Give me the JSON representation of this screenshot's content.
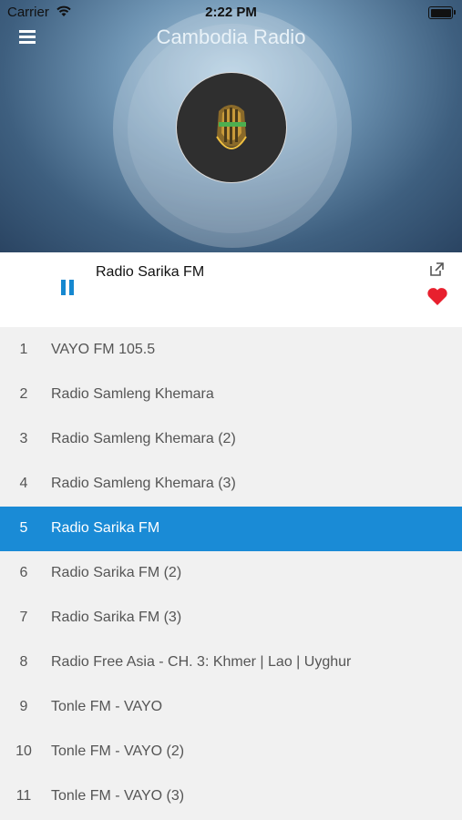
{
  "status_bar": {
    "carrier": "Carrier",
    "time": "2:22 PM"
  },
  "header": {
    "title": "Cambodia Radio"
  },
  "now_playing": {
    "title": "Radio Sarika FM"
  },
  "icons": {
    "menu": "hamburger-menu-icon",
    "pause": "pause-icon",
    "share": "share-icon",
    "favorite": "heart-icon"
  },
  "colors": {
    "accent": "#1a8bd6",
    "heart": "#e8202e"
  },
  "stations": [
    {
      "num": "1",
      "name": "VAYO FM 105.5"
    },
    {
      "num": "2",
      "name": "Radio Samleng Khemara"
    },
    {
      "num": "3",
      "name": "Radio Samleng Khemara (2)"
    },
    {
      "num": "4",
      "name": "Radio Samleng Khemara (3)"
    },
    {
      "num": "5",
      "name": "Radio Sarika FM",
      "active": true
    },
    {
      "num": "6",
      "name": "Radio Sarika FM (2)"
    },
    {
      "num": "7",
      "name": "Radio Sarika FM (3)"
    },
    {
      "num": "8",
      "name": "Radio Free Asia - CH. 3: Khmer | Lao | Uyghur"
    },
    {
      "num": "9",
      "name": "Tonle FM - VAYO"
    },
    {
      "num": "10",
      "name": "Tonle FM - VAYO (2)"
    },
    {
      "num": "11",
      "name": "Tonle FM - VAYO (3)"
    }
  ]
}
